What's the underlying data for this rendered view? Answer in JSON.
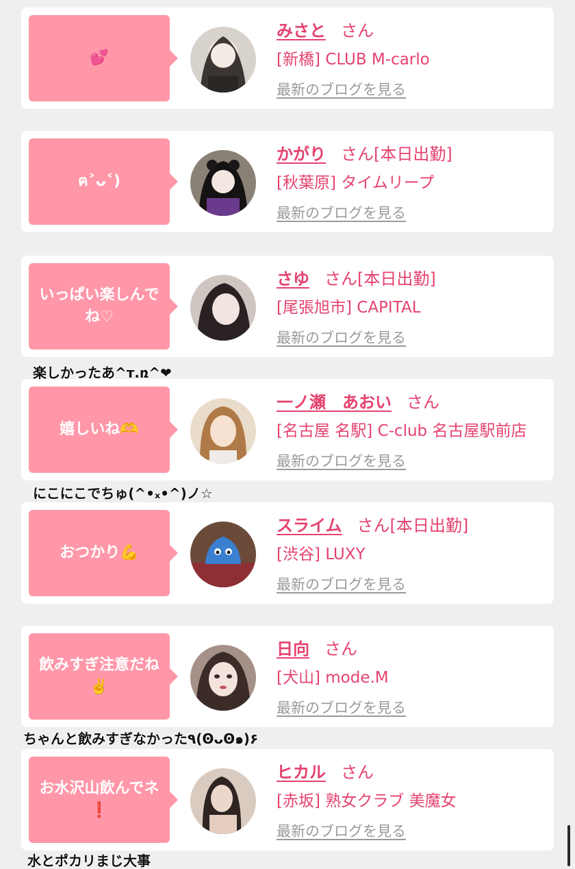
{
  "blog_label": "最新のブログを見る",
  "cast": [
    {
      "message": "💕",
      "name": "みさと",
      "suffix": "さん",
      "shop": "[新橋] CLUB M-carlo"
    },
    {
      "message": "ฅ˃ᴗ˂)",
      "name": "かがり",
      "suffix": "さん[本日出勤]",
      "shop": "[秋葉原] タイムリープ"
    },
    {
      "message": "いっぱい楽しんで\nね♡",
      "name": "さゆ",
      "suffix": "さん[本日出勤]",
      "shop": "[尾張旭市] CAPITAL"
    },
    {
      "message": "嬉しいね🫶",
      "name": "一ノ瀬　あおい",
      "suffix": "さん",
      "shop": "[名古屋 名駅] C-club 名古屋駅前店"
    },
    {
      "message": "おつかり💪",
      "name": "スライム",
      "suffix": "さん[本日出勤]",
      "shop": "[渋谷] LUXY"
    },
    {
      "message": "飲みすぎ注意だね\n✌️",
      "name": "日向",
      "suffix": "さん",
      "shop": "[犬山] mode.M"
    },
    {
      "message": "お水沢山飲んでネ\n❗",
      "name": "ヒカル",
      "suffix": "さん",
      "shop": "[赤坂] 熟女クラブ 美魔女"
    }
  ],
  "captions": [
    "楽しかったあ^ᴛ.ռ^❤",
    "にこにこでちゅ(^•ₓ•^)ノ☆",
    "ちゃんと飲みすぎなかった٩(ꙨᴗꙨ๑)۶",
    "水とポカリまじ大事"
  ],
  "colors": {
    "accent": "#e5426e",
    "bubble": "#ff97a9",
    "link": "#9a9a9a",
    "background": "#efefef"
  },
  "icons": [
    "avatar-photo-icon"
  ]
}
